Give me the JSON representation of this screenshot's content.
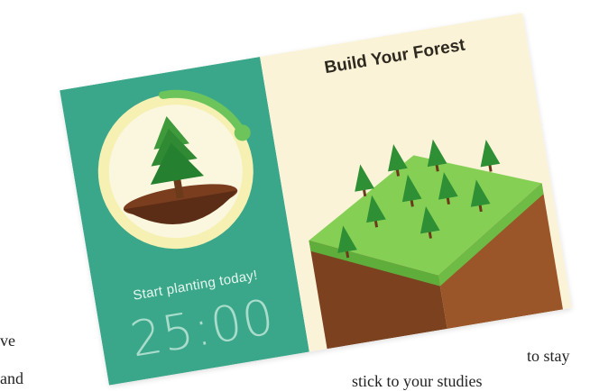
{
  "background": {
    "left_line_1": "ve",
    "left_line_2": "and",
    "right_line_1": "to stay",
    "right_line_2": "stick to your studies"
  },
  "app_promo": {
    "timer_panel": {
      "tagline": "Start planting today!",
      "time": "25:00",
      "colors": {
        "panel": "#3aa78b",
        "ring": "#f6f0b2",
        "progress": "#6cc45a"
      }
    },
    "forest_panel": {
      "title": "Build Your Forest",
      "colors": {
        "panel": "#fbf3d8",
        "grass": "#79c94f",
        "soil": "#8a4a24"
      }
    }
  }
}
